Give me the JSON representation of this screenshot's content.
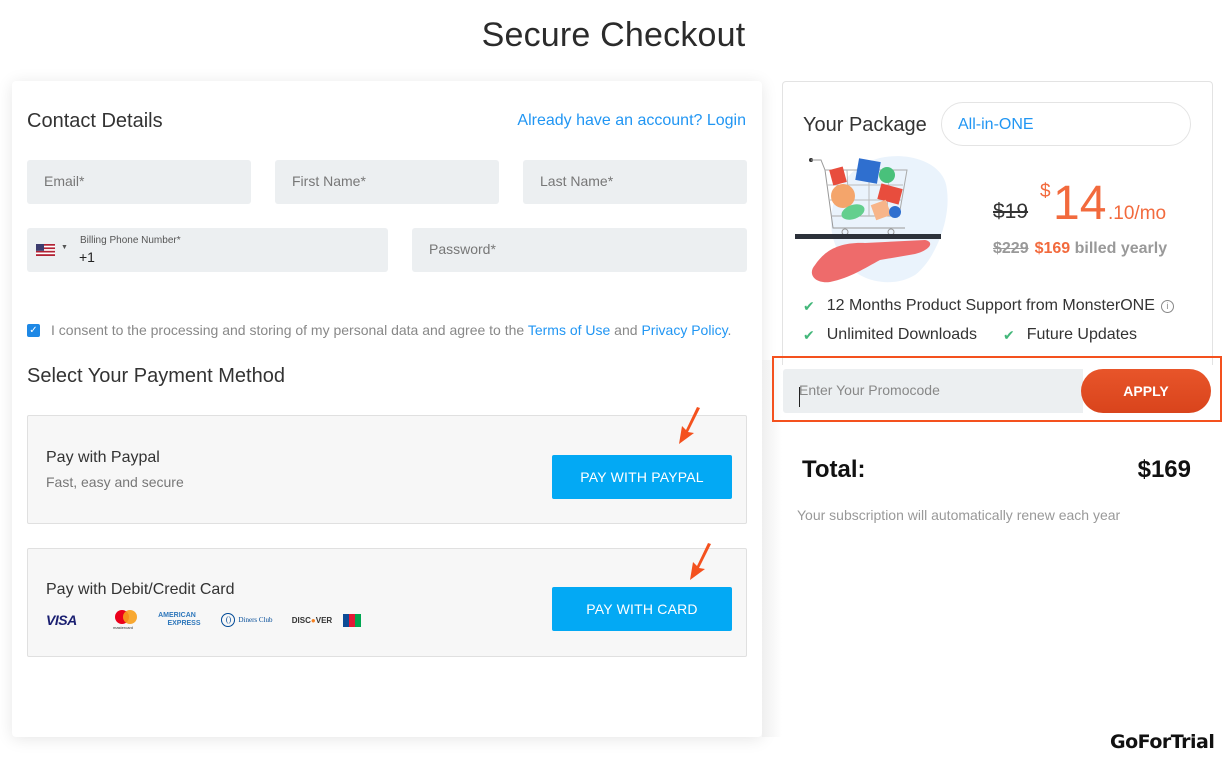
{
  "page": {
    "title": "Secure Checkout",
    "watermark": "GoForTrial"
  },
  "contact": {
    "title": "Contact Details",
    "login_link": "Already have an account? Login",
    "fields": {
      "email_placeholder": "Email*",
      "first_name_placeholder": "First Name*",
      "last_name_placeholder": "Last Name*",
      "phone_label": "Billing Phone Number*",
      "phone_value": "+1",
      "phone_country_icon": "us-flag-icon",
      "password_placeholder": "Password*"
    },
    "consent": {
      "checked": true,
      "text": "I consent to the processing and storing of my personal data and agree to the ",
      "terms_link": "Terms of Use",
      "and": " and ",
      "privacy_link": "Privacy Policy",
      "end": "."
    }
  },
  "payment": {
    "title": "Select Your Payment Method",
    "paypal": {
      "name": "Pay with Paypal",
      "subtitle": "Fast, easy and secure",
      "button": "PAY WITH PAYPAL"
    },
    "card": {
      "name": "Pay with Debit/Credit Card",
      "button": "PAY WITH CARD",
      "logos": [
        "VISA",
        "mastercard",
        "AMERICAN EXPRESS",
        "Diners Club International",
        "DISCOVER",
        "JCB"
      ]
    }
  },
  "package": {
    "label": "Your Package",
    "selected": "All-in-ONE",
    "old_monthly": "$19",
    "currency": "$",
    "price_int": "14",
    "price_dec": ".10/mo",
    "old_yearly": "$229",
    "new_yearly": "$169",
    "billed_text": " billed yearly",
    "features": [
      "12 Months Product Support from MonsterONE",
      "Unlimited Downloads",
      "Future Updates"
    ],
    "info_icon": "i"
  },
  "promo": {
    "placeholder": "Enter Your Promocode",
    "button": "APPLY"
  },
  "summary": {
    "total_label": "Total:",
    "total_value": "$169",
    "renew_note": "Your subscription will automatically renew each year"
  },
  "colors": {
    "accent_blue": "#03a9f4",
    "link_blue": "#2196f3",
    "price_orange": "#f26a3d",
    "apply_red": "#e04d22",
    "check_green": "#43b77a"
  }
}
